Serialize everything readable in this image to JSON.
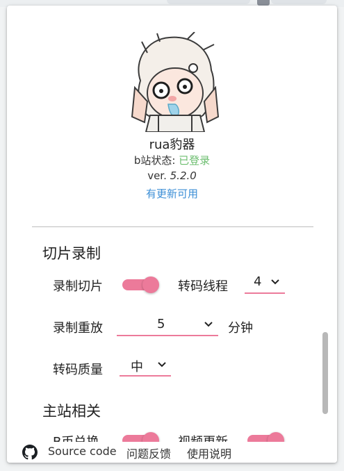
{
  "profile": {
    "username": "rua豹器",
    "status_label": "b站状态:",
    "status_value": "已登录",
    "version_prefix": "ver.",
    "version": "5.2.0",
    "update_link": "有更新可用"
  },
  "clip_section": {
    "title": "切片录制",
    "record_clips_label": "录制切片",
    "record_clips_on": true,
    "transcode_threads_label": "转码线程",
    "transcode_threads_value": "4",
    "record_replay_label": "录制重放",
    "record_replay_value": "5",
    "minutes_unit": "分钟",
    "transcode_quality_label": "转码质量",
    "transcode_quality_value": "中"
  },
  "main_section": {
    "title": "主站相关",
    "b_follow_label": "B币兑换",
    "b_follow_on": true,
    "video_update_label": "视频更新",
    "video_update_on": true
  },
  "footer": {
    "source_code": "Source code",
    "feedback": "问题反馈",
    "instructions": "使用说明"
  },
  "colors": {
    "accent": "#ec7a9a",
    "logged_in": "#6bbd6e",
    "link": "#3d8fd6"
  }
}
